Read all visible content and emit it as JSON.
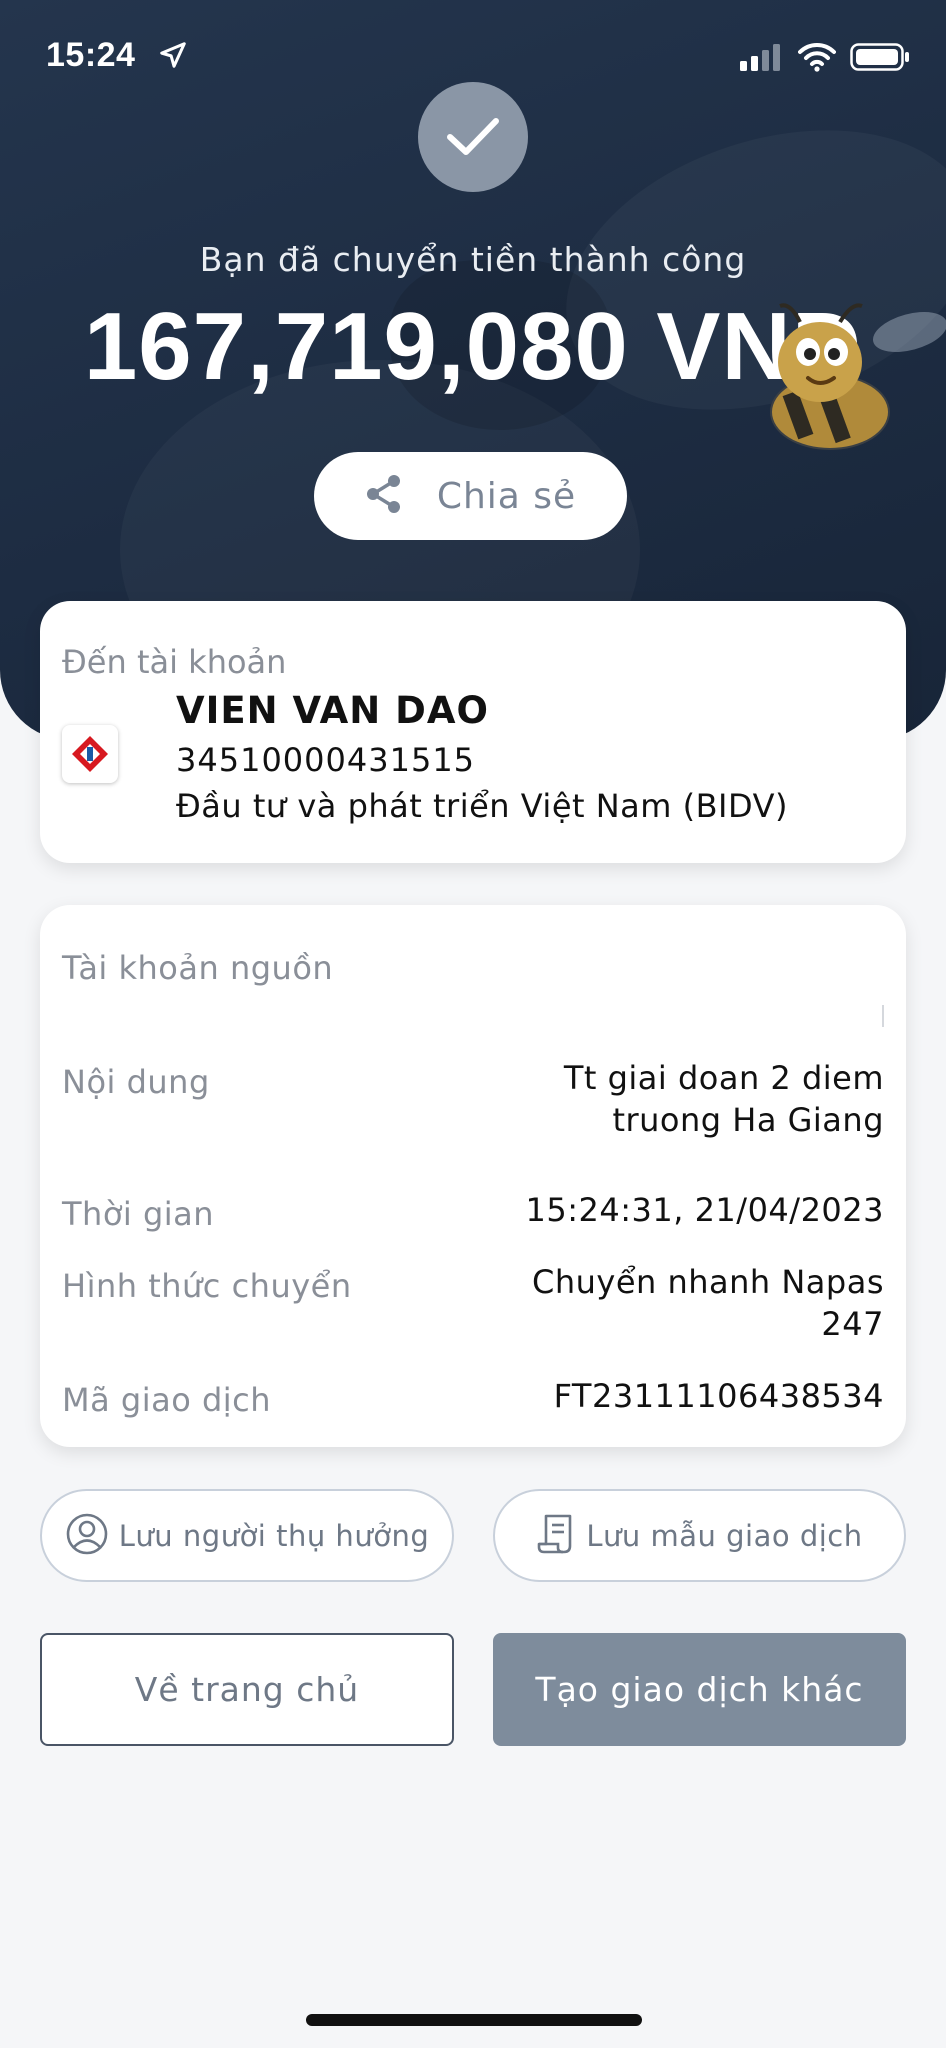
{
  "status_bar": {
    "time": "15:24"
  },
  "success": {
    "message": "Bạn đã chuyển tiền thành công",
    "amount": "167,719,080 VND",
    "share_label": "Chia sẻ"
  },
  "destination": {
    "label": "Đến tài khoản",
    "name": "VIEN VAN DAO",
    "account_number": "34510000431515",
    "bank": "Đầu tư và phát triển Việt Nam (BIDV)"
  },
  "details": {
    "source_label": "Tài khoản nguồn",
    "rows": [
      {
        "label": "Nội dung",
        "value_line1": "Tt giai doan 2 diem",
        "value_line2": "truong Ha Giang"
      },
      {
        "label": "Thời gian",
        "value_line1": "15:24:31, 21/04/2023"
      },
      {
        "label": "Hình thức chuyển",
        "value_line1": "Chuyển nhanh Napas",
        "value_line2": "247"
      },
      {
        "label": "Mã giao dịch",
        "value_line1": "FT23111106438534"
      }
    ]
  },
  "actions": {
    "save_beneficiary": "Lưu người thụ hưởng",
    "save_template": "Lưu mẫu giao dịch",
    "home": "Về trang chủ",
    "new_transaction": "Tạo giao dịch khác"
  },
  "colors": {
    "header_bg": "#1f2f45",
    "primary_button": "#7e8c9c",
    "bidv_red": "#d71920"
  }
}
